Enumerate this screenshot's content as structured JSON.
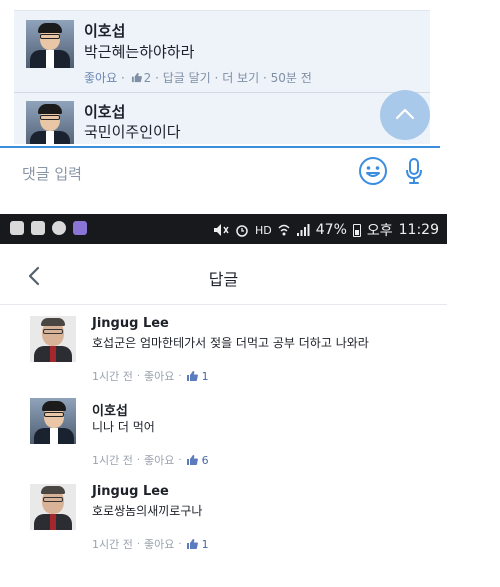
{
  "top_panel": {
    "comments": [
      {
        "author": "이호섭",
        "text": "박근혜는하야하라",
        "like_label": "좋아요",
        "like_count": "2",
        "reply_label": "답글 달기",
        "more_label": "더 보기",
        "time": "50분 전",
        "separator": "·"
      },
      {
        "author": "이호섭",
        "text": "국민이주인이다"
      }
    ],
    "reply_input": {
      "placeholder": "댓글 입력"
    },
    "icons": {
      "scroll_up": "chevron-up-icon",
      "emoji": "emoji-icon",
      "mic": "microphone-icon"
    },
    "accent_color": "#3b8de0"
  },
  "status_bar": {
    "battery_pct": "47%",
    "period": "오후",
    "clock": "11:29",
    "hd_label": "HD"
  },
  "replies_screen": {
    "title": "답글",
    "back_icon": "chevron-left-icon",
    "replies": [
      {
        "author": "Jingug Lee",
        "text": "호섭군은 엄마한테가서 젖을 더먹고 공부 더하고 나와라",
        "time": "1시간 전",
        "like_label": "좋아요",
        "like_count": "1",
        "separator": "·"
      },
      {
        "author": "이호섭",
        "text": "니나 더 먹어",
        "time": "1시간 전",
        "like_label": "좋아요",
        "like_count": "6",
        "separator": "·"
      },
      {
        "author": "Jingug Lee",
        "text": "호로쌍놈의새끼로구나",
        "time": "1시간 전",
        "like_label": "좋아요",
        "like_count": "1",
        "separator": "·"
      }
    ]
  }
}
